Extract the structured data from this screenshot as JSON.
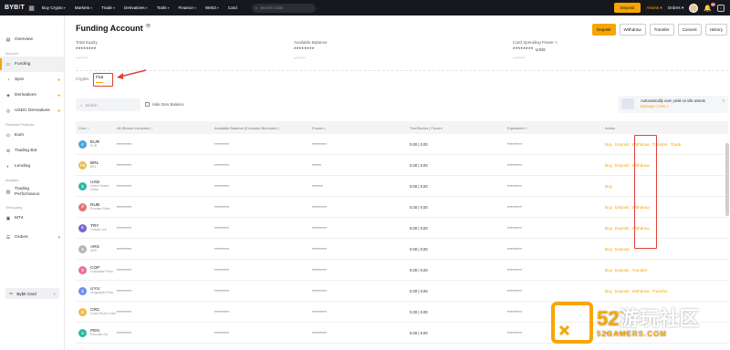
{
  "topbar": {
    "logo_main": "BYB",
    "logo_accent": "I",
    "logo_end": "T",
    "nav": [
      "Buy Crypto",
      "Markets",
      "Trade",
      "Derivatives",
      "Tools",
      "Finance",
      "Web3",
      "Card"
    ],
    "search_placeholder": "Search Coins",
    "deposit": "Deposit",
    "assets": "Assets",
    "orders": "Orders",
    "notif_count": "99"
  },
  "sidebar": {
    "overview": "Overview",
    "section_account": "Account",
    "funding": "Funding",
    "spot": "Spot",
    "derivatives": "Derivatives",
    "usdc": "USDC Derivatives",
    "section_financial": "Financial Products",
    "earn": "Earn",
    "trading_bot": "Trading Bot",
    "lending": "Lending",
    "section_analysis": "Analysis",
    "trading_performance_1": "Trading",
    "trading_performance_2": "Performance",
    "section_third": "Third-party",
    "mt4": "MT4",
    "orders": "Orders",
    "bybit_card": "Bybit Card"
  },
  "main": {
    "title": "Funding Account",
    "buttons": [
      "Deposit",
      "Withdraw",
      "Transfer",
      "Convert",
      "History"
    ],
    "stats": [
      {
        "label": "Total Equity",
        "value": "********",
        "sub": "≈*******"
      },
      {
        "label": "Available Balance",
        "value": "********",
        "sub": "≈*******"
      },
      {
        "label": "Card Spending Power >",
        "value": "********",
        "unit": "USD",
        "sub": "≈*******"
      }
    ],
    "tabs": [
      "Crypto",
      "Fiat"
    ],
    "search_placeholder": "Search",
    "hide_zero": "Hide Zero Balance",
    "earn_text": "Automatically earn yield on idle assets",
    "earn_link": "Manage Coins >"
  },
  "table": {
    "headers": [
      "Coin ↕",
      "All (Bonus Inclusive) ↕",
      "Available Balance (Excludes Bonuses) ↕",
      "Frozen ↕",
      "Trial Bonus | Frozen",
      "Equivalent ↕",
      "Action"
    ],
    "rows": [
      {
        "code": "EUR",
        "name": "EUR",
        "color": "#4aa3df",
        "icon": "€",
        "all": "********",
        "avail": "********",
        "frozen": "********",
        "bonus": "0.00 | 0.00",
        "equiv": "********",
        "actions": [
          "Buy",
          "Deposit",
          "Withdraw",
          "Transfer",
          "Trade"
        ]
      },
      {
        "code": "BRL",
        "name": "BRL",
        "color": "#f0b94a",
        "icon": "R$",
        "all": "********",
        "avail": "********",
        "frozen": "*****",
        "bonus": "0.00 | 0.00",
        "equiv": "********",
        "actions": [
          "Buy",
          "Deposit",
          "Withdraw"
        ]
      },
      {
        "code": "USD",
        "name": "United States Dollar",
        "color": "#2bb7a6",
        "icon": "$",
        "all": "********",
        "avail": "********",
        "frozen": "******",
        "bonus": "0.00 | 0.00",
        "equiv": "********",
        "actions": [
          "Buy"
        ]
      },
      {
        "code": "RUB",
        "name": "Russian Ruble",
        "color": "#e0737a",
        "icon": "₽",
        "all": "********",
        "avail": "********",
        "frozen": "********",
        "bonus": "0.00 | 0.00",
        "equiv": "********",
        "actions": [
          "Buy",
          "Deposit",
          "Withdraw"
        ]
      },
      {
        "code": "TRY",
        "name": "Turkish Lira",
        "color": "#7a63d8",
        "icon": "₺",
        "all": "********",
        "avail": "********",
        "frozen": "********",
        "bonus": "0.00 | 0.00",
        "equiv": "********",
        "actions": [
          "Buy",
          "Deposit",
          "Withdraw"
        ]
      },
      {
        "code": "ARS",
        "name": "ARS",
        "color": "#b6b6b6",
        "icon": "$",
        "all": "********",
        "avail": "********",
        "frozen": "********",
        "bonus": "0.00 | 0.00",
        "equiv": "********",
        "actions": [
          "Buy",
          "Deposit"
        ]
      },
      {
        "code": "COP",
        "name": "Colombian Peso",
        "color": "#e86fa2",
        "icon": "$",
        "all": "********",
        "avail": "********",
        "frozen": "********",
        "bonus": "0.00 | 0.00",
        "equiv": "********",
        "actions": [
          "Buy",
          "Deposit",
          "Transfer"
        ]
      },
      {
        "code": "UYU",
        "name": "Uruguayan Peso",
        "color": "#6c8ef0",
        "icon": "$",
        "all": "********",
        "avail": "********",
        "frozen": "********",
        "bonus": "0.00 | 0.00",
        "equiv": "********",
        "actions": [
          "Buy",
          "Deposit",
          "Withdraw",
          "Transfer"
        ]
      },
      {
        "code": "CRC",
        "name": "Costa Rican Colon",
        "color": "#f0b94a",
        "icon": "₡",
        "all": "********",
        "avail": "********",
        "frozen": "********",
        "bonus": "0.00 | 0.00",
        "equiv": "********",
        "actions": [
          "Buy",
          "Deposit"
        ]
      },
      {
        "code": "PEN",
        "name": "Peruvian Sol",
        "color": "#2bb7a6",
        "icon": "S",
        "all": "********",
        "avail": "********",
        "frozen": "********",
        "bonus": "0.00 | 0.00",
        "equiv": "********",
        "actions": [
          "Buy",
          "Deposit"
        ]
      }
    ]
  },
  "watermark": {
    "num": "52",
    "cn": "游玩社区",
    "en": "52GAMERS.COM"
  }
}
